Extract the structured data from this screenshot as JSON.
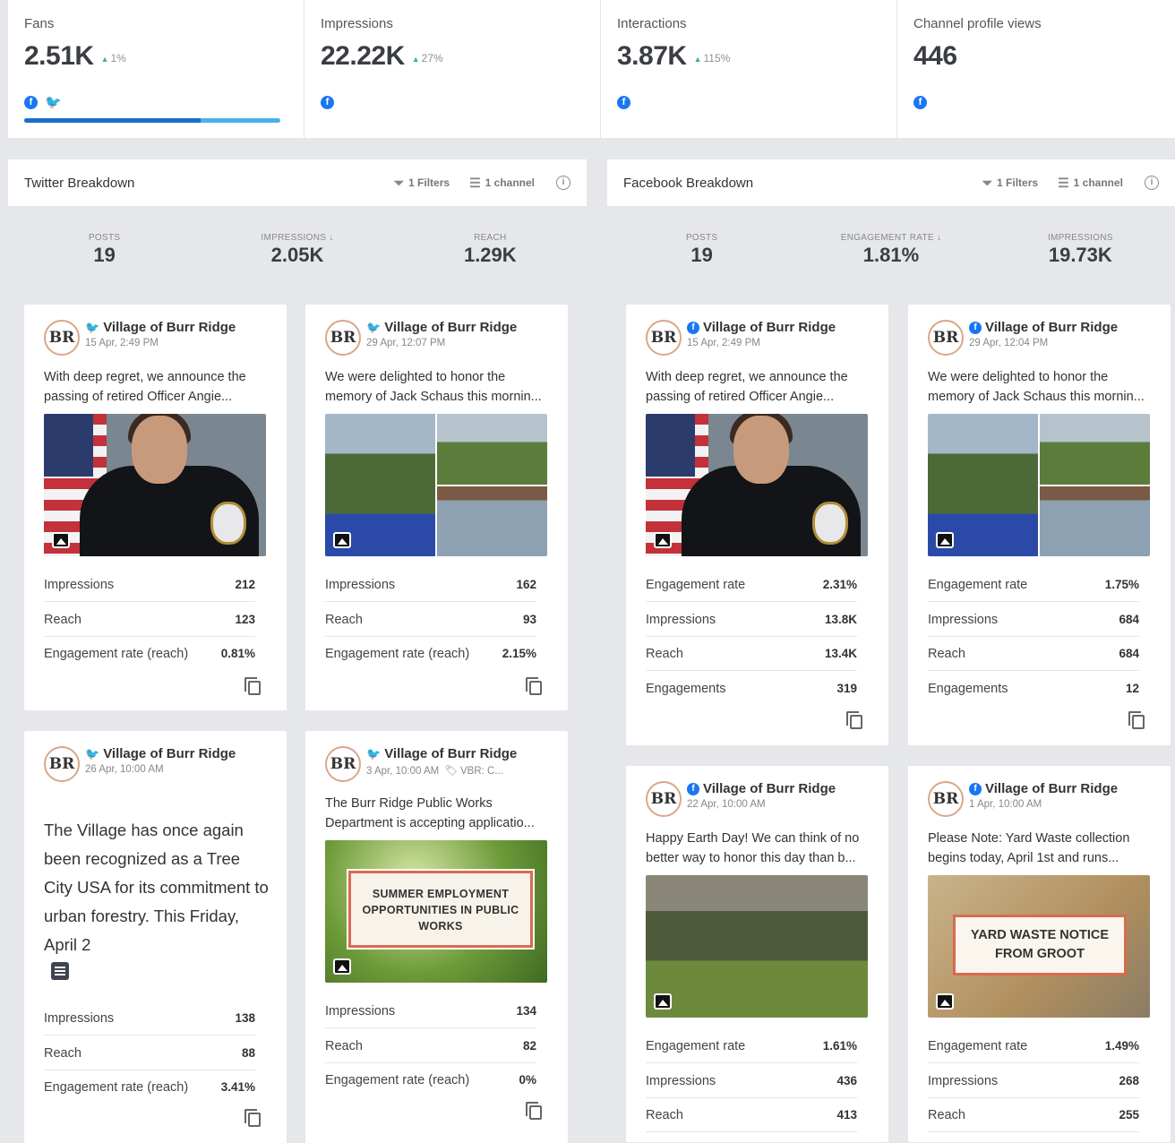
{
  "summary": [
    {
      "label": "Fans",
      "value": "2.51K",
      "delta": "1%",
      "icons": [
        "facebook-icon",
        "twitter-icon"
      ],
      "progress": 0.69
    },
    {
      "label": "Impressions",
      "value": "22.22K",
      "delta": "27%",
      "icons": [
        "facebook-icon"
      ]
    },
    {
      "label": "Interactions",
      "value": "3.87K",
      "delta": "115%",
      "icons": [
        "facebook-icon"
      ]
    },
    {
      "label": "Channel profile views",
      "value": "446",
      "delta": "",
      "icons": [
        "facebook-icon"
      ]
    }
  ],
  "twitter": {
    "title": "Twitter Breakdown",
    "filters": "1 Filters",
    "channels": "1 channel",
    "stats": [
      {
        "label": "POSTS",
        "value": "19"
      },
      {
        "label": "IMPRESSIONS ↓",
        "value": "2.05K"
      },
      {
        "label": "REACH",
        "value": "1.29K"
      }
    ],
    "posts": [
      {
        "author": "Village of Burr Ridge",
        "date": "15 Apr, 2:49 PM",
        "text": "With deep regret, we announce the passing of retired Officer Angie...",
        "metrics": [
          {
            "label": "Impressions",
            "value": "212"
          },
          {
            "label": "Reach",
            "value": "123"
          },
          {
            "label": "Engagement rate (reach)",
            "value": "0.81%"
          }
        ]
      },
      {
        "author": "Village of Burr Ridge",
        "date": "29 Apr, 12:07 PM",
        "text": "We were delighted to honor the memory of Jack Schaus this mornin...",
        "metrics": [
          {
            "label": "Impressions",
            "value": "162"
          },
          {
            "label": "Reach",
            "value": "93"
          },
          {
            "label": "Engagement rate (reach)",
            "value": "2.15%"
          }
        ]
      },
      {
        "author": "Village of Burr Ridge",
        "date": "26 Apr, 10:00 AM",
        "text": "The Village has once again been recognized as a Tree City USA for its commitment to urban forestry. This Friday, April 2",
        "metrics": [
          {
            "label": "Impressions",
            "value": "138"
          },
          {
            "label": "Reach",
            "value": "88"
          },
          {
            "label": "Engagement rate (reach)",
            "value": "3.41%"
          }
        ]
      },
      {
        "author": "Village of Burr Ridge",
        "date": "3 Apr, 10:00 AM",
        "tag": "VBR: C...",
        "text": "The Burr Ridge Public Works Department is accepting applicatio...",
        "image_text": "SUMMER EMPLOYMENT OPPORTUNITIES IN PUBLIC WORKS",
        "metrics": [
          {
            "label": "Impressions",
            "value": "134"
          },
          {
            "label": "Reach",
            "value": "82"
          },
          {
            "label": "Engagement rate (reach)",
            "value": "0%"
          }
        ]
      }
    ]
  },
  "facebook": {
    "title": "Facebook Breakdown",
    "filters": "1 Filters",
    "channels": "1 channel",
    "stats": [
      {
        "label": "POSTS",
        "value": "19"
      },
      {
        "label": "ENGAGEMENT RATE ↓",
        "value": "1.81%"
      },
      {
        "label": "IMPRESSIONS",
        "value": "19.73K"
      }
    ],
    "posts": [
      {
        "author": "Village of Burr Ridge",
        "date": "15 Apr, 2:49 PM",
        "text": "With deep regret, we announce the passing of retired Officer Angie...",
        "metrics": [
          {
            "label": "Engagement rate",
            "value": "2.31%"
          },
          {
            "label": "Impressions",
            "value": "13.8K"
          },
          {
            "label": "Reach",
            "value": "13.4K"
          },
          {
            "label": "Engagements",
            "value": "319"
          }
        ]
      },
      {
        "author": "Village of Burr Ridge",
        "date": "29 Apr, 12:04 PM",
        "text": "We were delighted to honor the memory of Jack Schaus this mornin...",
        "metrics": [
          {
            "label": "Engagement rate",
            "value": "1.75%"
          },
          {
            "label": "Impressions",
            "value": "684"
          },
          {
            "label": "Reach",
            "value": "684"
          },
          {
            "label": "Engagements",
            "value": "12"
          }
        ]
      },
      {
        "author": "Village of Burr Ridge",
        "date": "22 Apr, 10:00 AM",
        "text": "Happy Earth Day! We can think of no better way to honor this day than b...",
        "metrics": [
          {
            "label": "Engagement rate",
            "value": "1.61%"
          },
          {
            "label": "Impressions",
            "value": "436"
          },
          {
            "label": "Reach",
            "value": "413"
          }
        ]
      },
      {
        "author": "Village of Burr Ridge",
        "date": "1 Apr, 10:00 AM",
        "text": "Please Note: Yard Waste collection begins today, April 1st and runs...",
        "image_text": "YARD WASTE NOTICE FROM GROOT",
        "metrics": [
          {
            "label": "Engagement rate",
            "value": "1.49%"
          },
          {
            "label": "Impressions",
            "value": "268"
          },
          {
            "label": "Reach",
            "value": "255"
          }
        ]
      }
    ]
  },
  "logo_text": "BR",
  "colors": {
    "facebook": "#1877f2",
    "twitter": "#1da1f2",
    "accent": "#1a6ec9",
    "positive": "#3bb87a"
  }
}
